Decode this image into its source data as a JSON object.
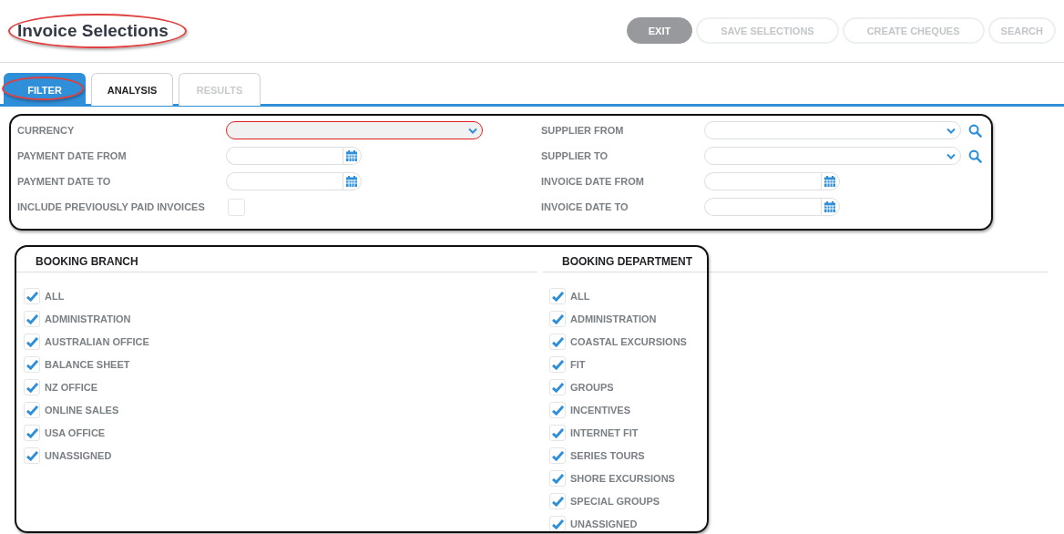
{
  "title": "Invoice Selections",
  "actions": [
    {
      "label": "EXIT",
      "disabled": false
    },
    {
      "label": "SAVE SELECTIONS",
      "disabled": true
    },
    {
      "label": "CREATE CHEQUES",
      "disabled": true
    },
    {
      "label": "SEARCH",
      "disabled": true
    }
  ],
  "tabs": [
    {
      "label": "FILTER",
      "selected": true,
      "disabled": false
    },
    {
      "label": "ANALYSIS",
      "selected": false,
      "disabled": false
    },
    {
      "label": "RESULTS",
      "selected": false,
      "disabled": true
    }
  ],
  "filters_left": [
    {
      "label": "CURRENCY",
      "kind": "select",
      "required": true
    },
    {
      "label": "PAYMENT DATE FROM",
      "kind": "date",
      "required": false
    },
    {
      "label": "PAYMENT DATE TO",
      "kind": "date",
      "required": false
    },
    {
      "label": "INCLUDE PREVIOUSLY PAID INVOICES",
      "kind": "checkbox",
      "required": false,
      "checked": false
    }
  ],
  "filters_right": [
    {
      "label": "SUPPLIER FROM",
      "kind": "lookup",
      "required": false
    },
    {
      "label": "SUPPLIER TO",
      "kind": "lookup",
      "required": false
    },
    {
      "label": "INVOICE DATE FROM",
      "kind": "date",
      "required": false
    },
    {
      "label": "INVOICE DATE TO",
      "kind": "date",
      "required": false
    }
  ],
  "booking_branch": {
    "heading": "BOOKING BRANCH",
    "items": [
      {
        "label": "ALL",
        "checked": true
      },
      {
        "label": "ADMINISTRATION",
        "checked": true
      },
      {
        "label": "AUSTRALIAN OFFICE",
        "checked": true
      },
      {
        "label": "BALANCE SHEET",
        "checked": true
      },
      {
        "label": "NZ OFFICE",
        "checked": true
      },
      {
        "label": "ONLINE SALES",
        "checked": true
      },
      {
        "label": "USA OFFICE",
        "checked": true
      },
      {
        "label": "UNASSIGNED",
        "checked": true
      }
    ]
  },
  "booking_department": {
    "heading": "BOOKING DEPARTMENT",
    "items": [
      {
        "label": "ALL",
        "checked": true
      },
      {
        "label": "ADMINISTRATION",
        "checked": true
      },
      {
        "label": "COASTAL EXCURSIONS",
        "checked": true
      },
      {
        "label": "FIT",
        "checked": true
      },
      {
        "label": "GROUPS",
        "checked": true
      },
      {
        "label": "INCENTIVES",
        "checked": true
      },
      {
        "label": "INTERNET FIT",
        "checked": true
      },
      {
        "label": "SERIES TOURS",
        "checked": true
      },
      {
        "label": "SHORE EXCURSIONS",
        "checked": true
      },
      {
        "label": "SPECIAL GROUPS",
        "checked": true
      },
      {
        "label": "UNASSIGNED",
        "checked": true
      }
    ]
  }
}
